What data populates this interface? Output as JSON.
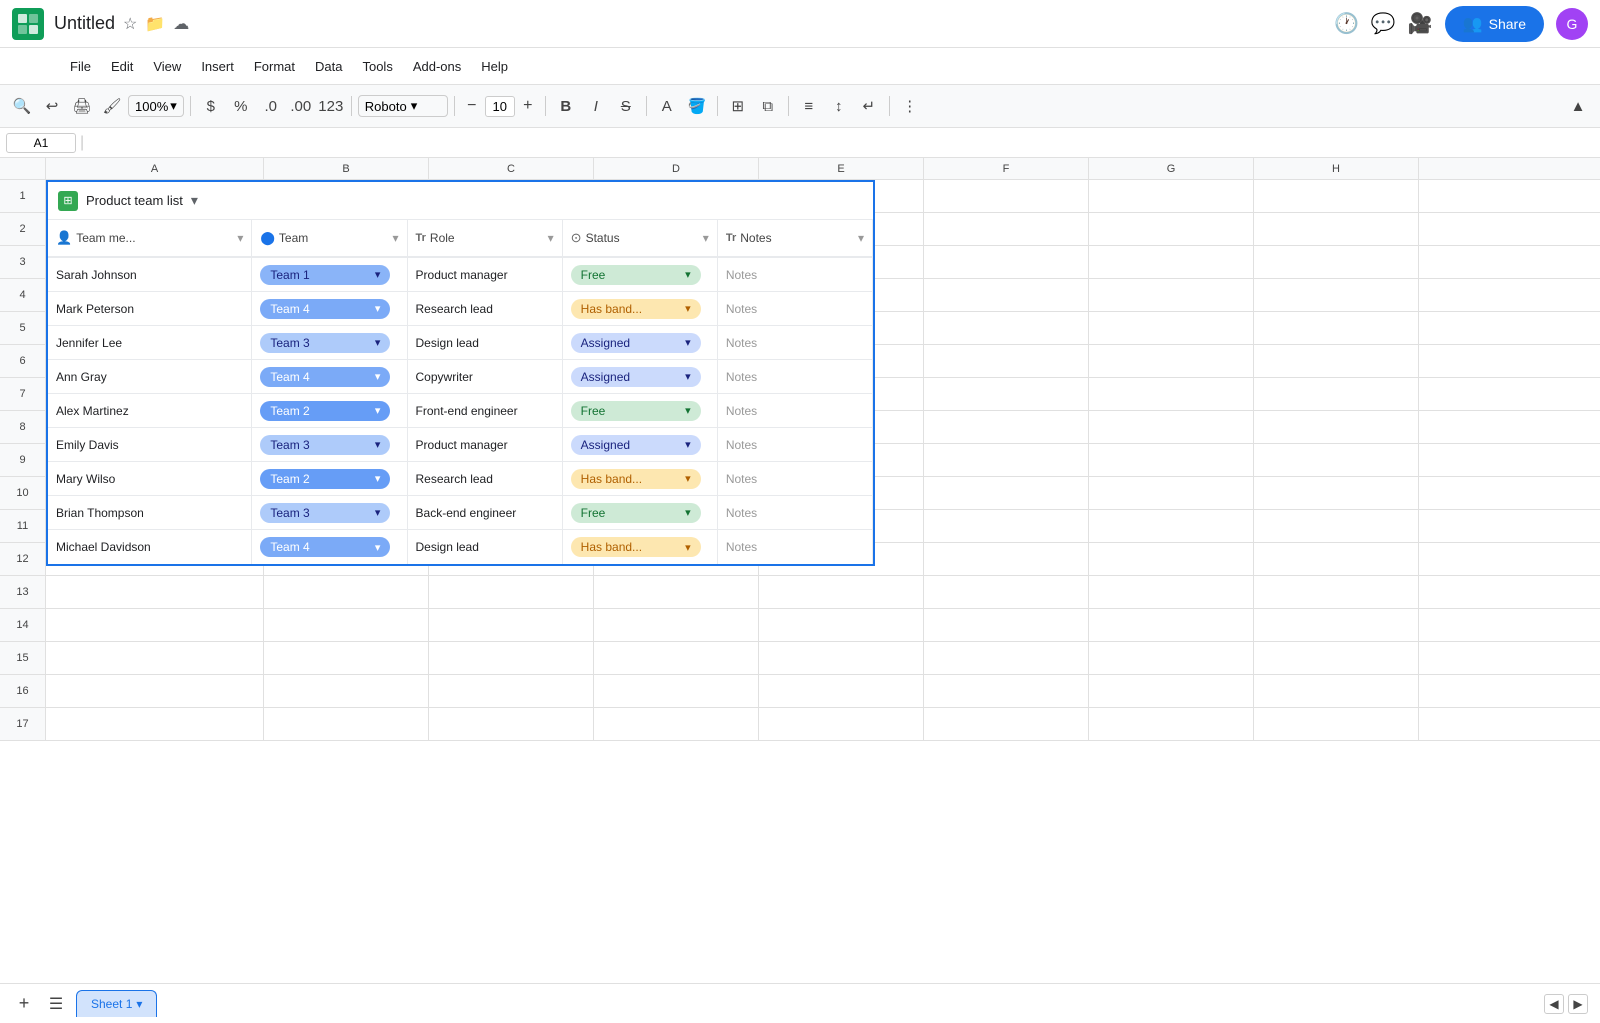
{
  "title": "Untitled",
  "menu": {
    "items": [
      "File",
      "Edit",
      "View",
      "Insert",
      "Format",
      "Data",
      "Tools",
      "Add-ons",
      "Help"
    ]
  },
  "toolbar": {
    "zoom": "100%",
    "font": "Roboto",
    "fontSize": "10",
    "bold_label": "B",
    "italic_label": "I",
    "strikethrough_label": "S"
  },
  "formula_bar": {
    "cell_ref": "A1"
  },
  "share_button": "Share",
  "table": {
    "label": "Product team list",
    "columns": [
      {
        "id": "team-member",
        "icon": "👤",
        "label": "Team me...",
        "arrow": "▾"
      },
      {
        "id": "team",
        "icon": "⬤",
        "label": "Team",
        "arrow": "▾"
      },
      {
        "id": "role",
        "icon": "Tr",
        "label": "Role",
        "arrow": "▾"
      },
      {
        "id": "status",
        "icon": "⊙",
        "label": "Status",
        "arrow": "▾"
      },
      {
        "id": "notes",
        "icon": "Tr",
        "label": "Notes",
        "arrow": "▾"
      }
    ],
    "rows": [
      {
        "id": 1,
        "member": "Sarah Johnson",
        "team": "Team 1",
        "team_class": "team-1",
        "role": "Product manager",
        "status": "Free",
        "status_class": "status-free",
        "notes": "Notes"
      },
      {
        "id": 2,
        "member": "Mark Peterson",
        "team": "Team 4",
        "team_class": "team-4",
        "role": "Research lead",
        "status": "Has band...",
        "status_class": "status-hasband",
        "notes": "Notes"
      },
      {
        "id": 3,
        "member": "Jennifer Lee",
        "team": "Team 3",
        "team_class": "team-3",
        "role": "Design lead",
        "status": "Assigned",
        "status_class": "status-assigned",
        "notes": "Notes"
      },
      {
        "id": 4,
        "member": "Ann Gray",
        "team": "Team 4",
        "team_class": "team-4",
        "role": "Copywriter",
        "status": "Assigned",
        "status_class": "status-assigned",
        "notes": "Notes"
      },
      {
        "id": 5,
        "member": "Alex Martinez",
        "team": "Team 2",
        "team_class": "team-2",
        "role": "Front-end engineer",
        "status": "Free",
        "status_class": "status-free",
        "notes": "Notes"
      },
      {
        "id": 6,
        "member": "Emily Davis",
        "team": "Team 3",
        "team_class": "team-3",
        "role": "Product manager",
        "status": "Assigned",
        "status_class": "status-assigned",
        "notes": "Notes"
      },
      {
        "id": 7,
        "member": "Mary Wilso",
        "team": "Team 2",
        "team_class": "team-2",
        "role": "Research lead",
        "status": "Has band...",
        "status_class": "status-hasband",
        "notes": "Notes"
      },
      {
        "id": 8,
        "member": "Brian Thompson",
        "team": "Team 3",
        "team_class": "team-3",
        "role": "Back-end engineer",
        "status": "Free",
        "status_class": "status-free",
        "notes": "Notes"
      },
      {
        "id": 9,
        "member": "Michael Davidson",
        "team": "Team 4",
        "team_class": "team-4",
        "role": "Design lead",
        "status": "Has band...",
        "status_class": "status-hasband",
        "notes": "Notes"
      }
    ]
  },
  "col_labels": [
    "A",
    "B",
    "C",
    "D",
    "E",
    "F",
    "G",
    "H"
  ],
  "row_numbers": [
    1,
    2,
    3,
    4,
    5,
    6,
    7,
    8,
    9,
    10,
    11,
    12,
    13,
    14,
    15,
    16,
    17
  ],
  "empty_rows": [
    10,
    11,
    12,
    13,
    14,
    15,
    16,
    17
  ],
  "sheet": {
    "name": "Sheet 1"
  }
}
